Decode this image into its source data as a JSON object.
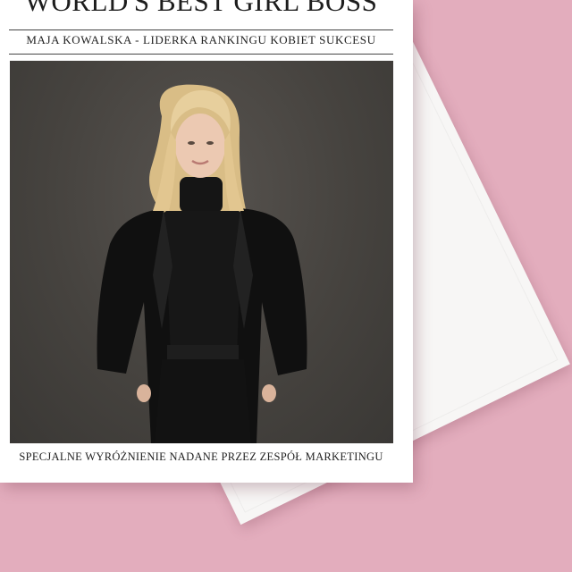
{
  "card": {
    "headline": "WORLD'S BEST GIRL BOSS",
    "subheadline": "MAJA KOWALSKA - LIDERKA RANKINGU KOBIET SUKCESU",
    "caption": "SPECJALNE WYRÓŻNIENIE NADANE PRZEZ ZESPÓŁ MARKETINGU"
  },
  "colors": {
    "background": "#e3adbd",
    "card": "#ffffff",
    "envelope": "#f7f6f5",
    "photo_background": "#46433f",
    "outfit": "#141414",
    "hair": "#e7cf9d"
  }
}
